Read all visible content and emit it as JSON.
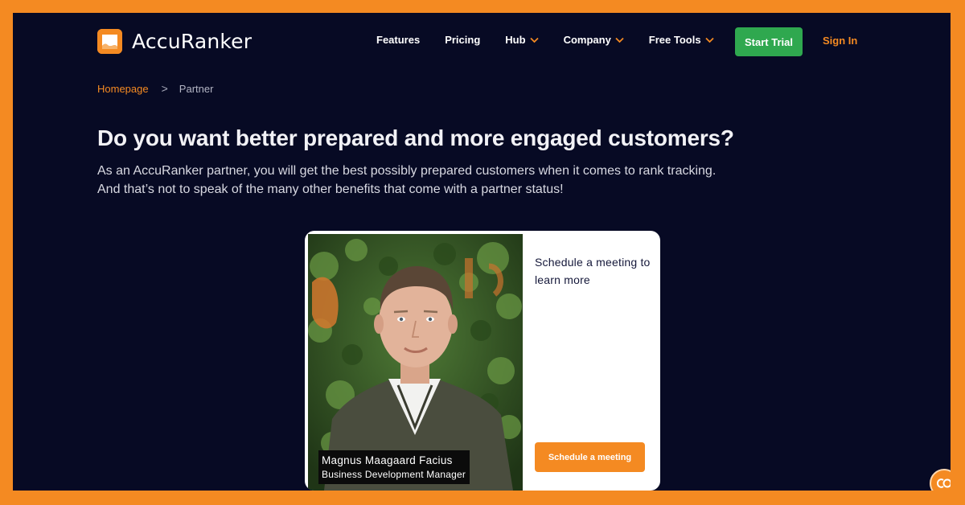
{
  "brand": {
    "name": "AccuRanker",
    "accent_color": "#f48a22",
    "background_color": "#070a24",
    "cta_color": "#2fa84f"
  },
  "nav": {
    "items": [
      {
        "label": "Features",
        "has_dropdown": false
      },
      {
        "label": "Pricing",
        "has_dropdown": false
      },
      {
        "label": "Hub",
        "has_dropdown": true
      },
      {
        "label": "Company",
        "has_dropdown": true
      },
      {
        "label": "Free Tools",
        "has_dropdown": true
      }
    ],
    "start_trial": "Start Trial",
    "sign_in": "Sign In"
  },
  "breadcrumb": {
    "home": "Homepage",
    "separator": ">",
    "current": "Partner"
  },
  "hero": {
    "headline": "Do you want better prepared and more engaged customers?",
    "subtext": "As an AccuRanker partner, you will get the best possibly prepared customers when it comes to rank tracking. And that’s not to speak of the many other benefits that come with a partner status!"
  },
  "card": {
    "person_name": "Magnus Maagaard Facius",
    "person_role": "Business Development Manager",
    "prompt": "Schedule a meeting to learn more",
    "button": "Schedule a meeting"
  },
  "chat": {
    "icon": "chat-bubble-icon"
  }
}
